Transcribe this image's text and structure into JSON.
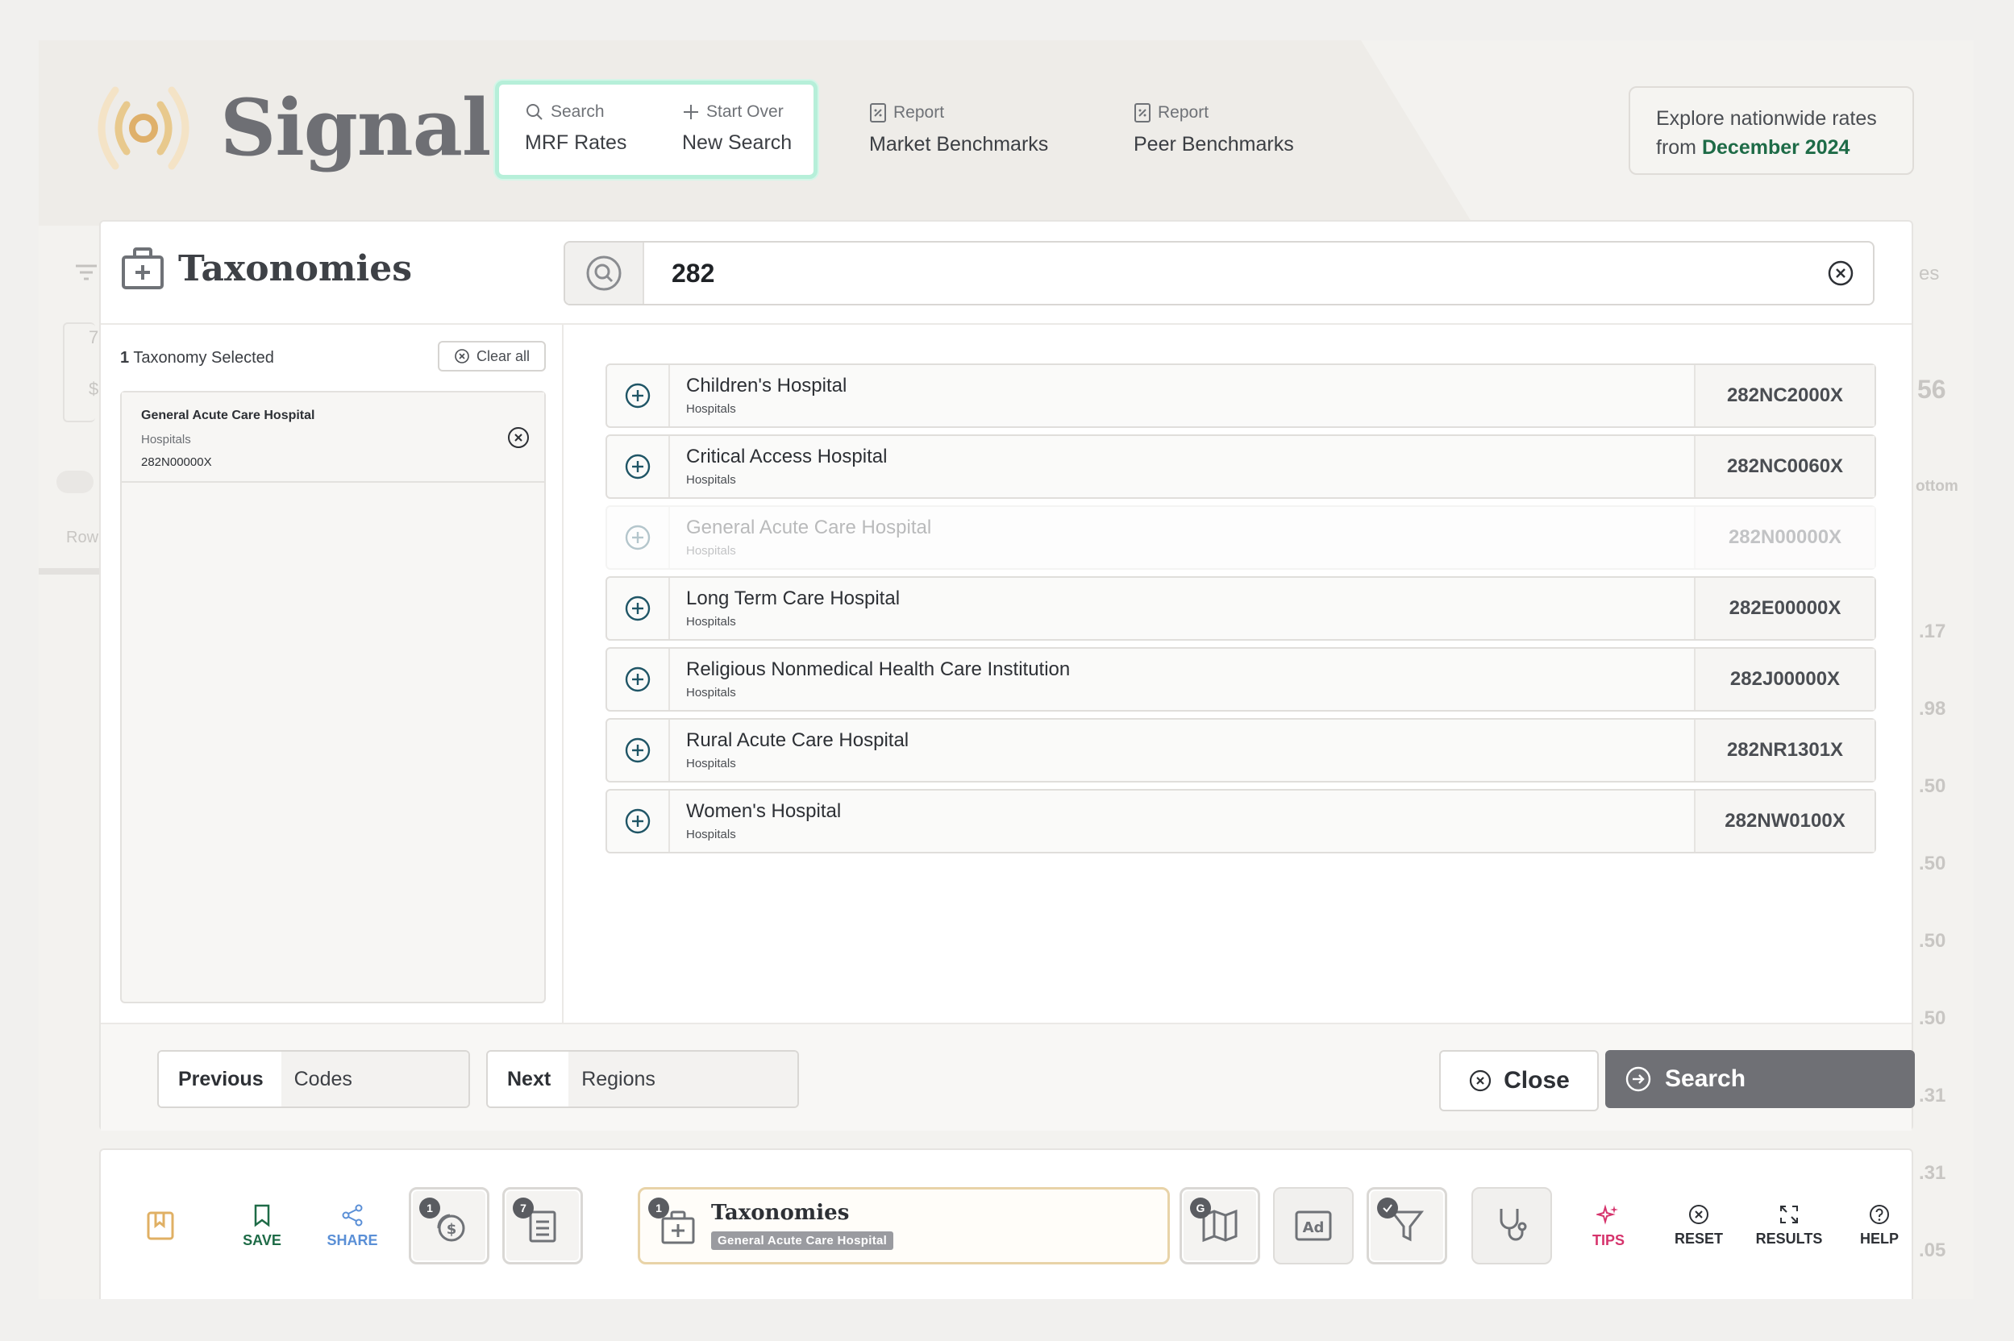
{
  "app": {
    "name": "Signal"
  },
  "nav": {
    "search": {
      "top": "Search",
      "bottom": "MRF Rates"
    },
    "start_over": {
      "top": "Start Over",
      "bottom": "New Search"
    },
    "market": {
      "top": "Report",
      "bottom": "Market Benchmarks"
    },
    "peer": {
      "top": "Report",
      "bottom": "Peer Benchmarks"
    }
  },
  "rates_box": {
    "line1": "Explore nationwide rates",
    "from": "from",
    "date": "December 2024"
  },
  "background": {
    "rows_label": "Row",
    "ottom": "ottom",
    "es": "es",
    "n56": "56",
    "n7": "7",
    "dollar": "$",
    "values": [
      ".17",
      ".98",
      ".50",
      ".50",
      ".50",
      ".50",
      ".31",
      ".31",
      ".05"
    ]
  },
  "modal": {
    "title": "Taxonomies",
    "search_value": "282",
    "selected_count": "1",
    "selected_label": "Taxonomy Selected",
    "clear_all": "Clear all",
    "selected": [
      {
        "name": "General Acute Care Hospital",
        "category": "Hospitals",
        "code": "282N00000X"
      }
    ],
    "results": [
      {
        "name": "Children's Hospital",
        "category": "Hospitals",
        "code": "282NC2000X",
        "disabled": false
      },
      {
        "name": "Critical Access Hospital",
        "category": "Hospitals",
        "code": "282NC0060X",
        "disabled": false
      },
      {
        "name": "General Acute Care Hospital",
        "category": "Hospitals",
        "code": "282N00000X",
        "disabled": true
      },
      {
        "name": "Long Term Care Hospital",
        "category": "Hospitals",
        "code": "282E00000X",
        "disabled": false
      },
      {
        "name": "Religious Nonmedical Health Care Institution",
        "category": "Hospitals",
        "code": "282J00000X",
        "disabled": false
      },
      {
        "name": "Rural Acute Care Hospital",
        "category": "Hospitals",
        "code": "282NR1301X",
        "disabled": false
      },
      {
        "name": "Women's Hospital",
        "category": "Hospitals",
        "code": "282NW0100X",
        "disabled": false
      }
    ],
    "footer": {
      "previous": "Previous",
      "previous_target": "Codes",
      "next": "Next",
      "next_target": "Regions",
      "close": "Close",
      "search": "Search"
    }
  },
  "toolbar": {
    "save": "SAVE",
    "share": "SHARE",
    "rates_badge": "1",
    "codes_badge": "7",
    "taxonomy_badge": "1",
    "regions_badge": "G",
    "taxonomy_title": "Taxonomies",
    "taxonomy_tag": "General Acute Care Hospital",
    "tips": "TIPS",
    "reset": "RESET",
    "results": "RESULTS",
    "help": "HELP"
  },
  "colors": {
    "accent_green": "#1e6b47",
    "nav_highlight": "#b6efd9",
    "search_button": "#6f7075",
    "tips_pink": "#d6336c",
    "share_blue": "#5a8fd6"
  }
}
